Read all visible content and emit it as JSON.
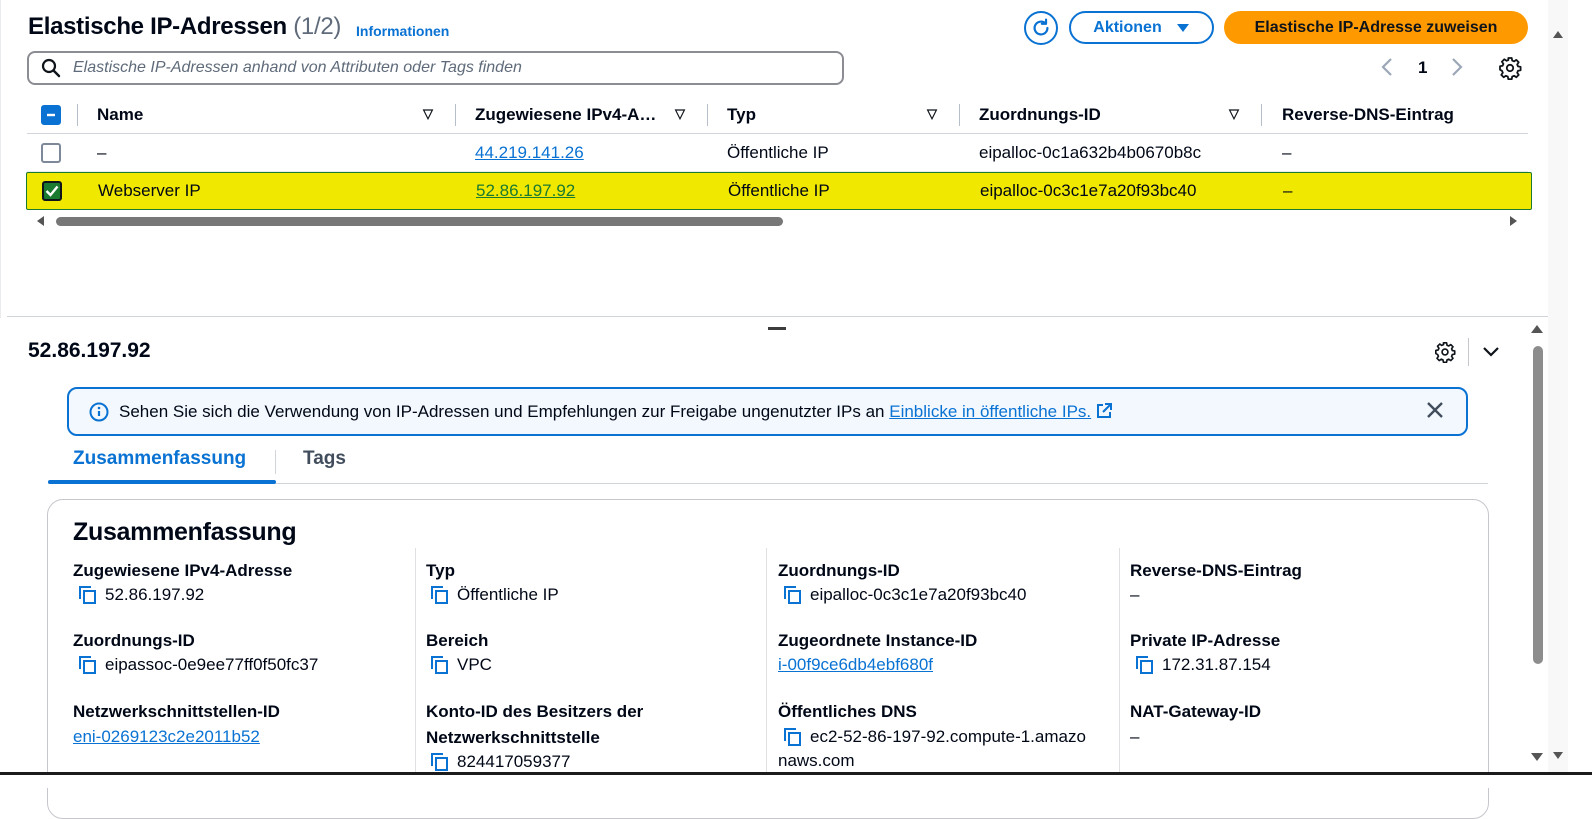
{
  "header": {
    "title": "Elastische IP-Adressen",
    "count": "(1/2)",
    "info_link": "Informationen",
    "actions_label": "Aktionen",
    "primary_label": "Elastische IP-Adresse zuweisen"
  },
  "search": {
    "placeholder": "Elastische IP-Adressen anhand von Attributen oder Tags finden"
  },
  "pagination": {
    "page": "1"
  },
  "table": {
    "columns": [
      "Name",
      "Zugewiesene IPv4-A…",
      "Typ",
      "Zuordnungs-ID",
      "Reverse-DNS-Eintrag"
    ],
    "rows": [
      {
        "name": "–",
        "ip": "44.219.141.26",
        "type": "Öffentliche IP",
        "alloc_id": "eipalloc-0c1a632b4b0670b8c",
        "rdns": "–",
        "selected": false
      },
      {
        "name": "Webserver IP",
        "ip": "52.86.197.92",
        "type": "Öffentliche IP",
        "alloc_id": "eipalloc-0c3c1e7a20f93bc40",
        "rdns": "–",
        "selected": true
      }
    ]
  },
  "details": {
    "title": "52.86.197.92",
    "alert_text": "Sehen Sie sich die Verwendung von IP-Adressen und Empfehlungen zur Freigabe ungenutzter IPs an",
    "alert_link": "Einblicke in öffentliche IPs.",
    "tabs": [
      "Zusammenfassung",
      "Tags"
    ],
    "summary_title": "Zusammenfassung",
    "fields": {
      "ipv4_label": "Zugewiesene IPv4-Adresse",
      "ipv4_value": "52.86.197.92",
      "typ_label": "Typ",
      "typ_value": "Öffentliche IP",
      "alloc_label": "Zuordnungs-ID",
      "alloc_value": "eipalloc-0c3c1e7a20f93bc40",
      "rdns_label": "Reverse-DNS-Eintrag",
      "rdns_value": "–",
      "assoc_label": "Zuordnungs-ID",
      "assoc_value": "eipassoc-0e9ee77ff0f50fc37",
      "scope_label": "Bereich",
      "scope_value": "VPC",
      "instance_label": "Zugeordnete Instance-ID",
      "instance_value": "i-00f9ce6db4ebf680f",
      "private_ip_label": "Private IP-Adresse",
      "private_ip_value": "172.31.87.154",
      "eni_label": "Netzwerkschnittstellen-ID",
      "eni_value": "eni-0269123c2e2011b52",
      "owner_label_1": "Konto-ID des Besitzers der",
      "owner_label_2": "Netzwerkschnittstelle",
      "owner_value": "824417059377",
      "dns_label": "Öffentliches DNS",
      "dns_value_1": "ec2-52-86-197-92.compute-1.amazo",
      "dns_value_2": "naws.com",
      "nat_label": "NAT-Gateway-ID",
      "nat_value": "–"
    }
  },
  "colors": {
    "accent": "#0972d3",
    "primary": "#ff9900",
    "highlight": "#f1e800",
    "selected_check": "#1a7a30"
  }
}
